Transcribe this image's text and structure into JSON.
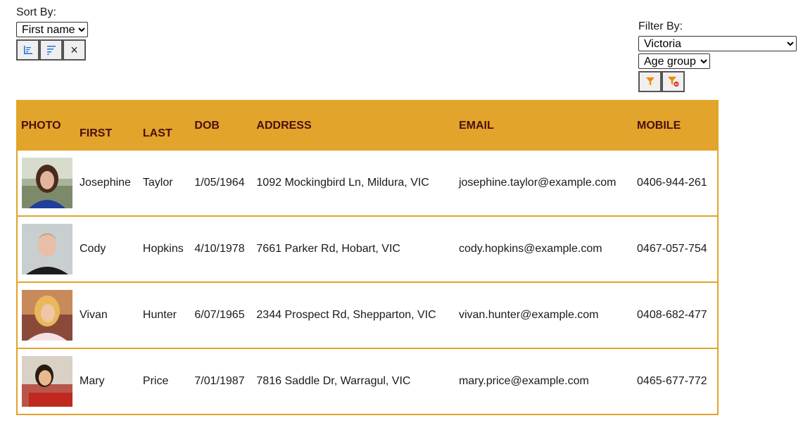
{
  "sort": {
    "label": "Sort By:",
    "selected": "First name",
    "buttons": {
      "ascending": "sort-ascending-icon",
      "descending": "sort-descending-icon",
      "clear": "×"
    }
  },
  "filter": {
    "label": "Filter By:",
    "location_selected": "Victoria",
    "age_selected": "Age group",
    "buttons": {
      "apply": "filter-icon",
      "clear": "filter-clear-icon"
    }
  },
  "table": {
    "columns": [
      "PHOTO",
      "FIRST",
      "LAST",
      "DOB",
      "ADDRESS",
      "EMAIL",
      "MOBILE"
    ],
    "rows": [
      {
        "first": "Josephine",
        "last": "Taylor",
        "dob": "1/05/1964",
        "address": "1092 Mockingbird Ln, Mildura, VIC",
        "email": "josephine.taylor@example.com",
        "mobile": "0406-944-261"
      },
      {
        "first": "Cody",
        "last": "Hopkins",
        "dob": "4/10/1978",
        "address": "7661 Parker Rd, Hobart, VIC",
        "email": "cody.hopkins@example.com",
        "mobile": "0467-057-754"
      },
      {
        "first": "Vivan",
        "last": "Hunter",
        "dob": "6/07/1965",
        "address": "2344 Prospect Rd, Shepparton, VIC",
        "email": "vivan.hunter@example.com",
        "mobile": "0408-682-477"
      },
      {
        "first": "Mary",
        "last": "Price",
        "dob": "7/01/1987",
        "address": "7816 Saddle Dr, Warragul, VIC",
        "email": "mary.price@example.com",
        "mobile": "0465-677-772"
      }
    ]
  },
  "colors": {
    "accent": "#e2a42a",
    "header_text": "#4b0f0f",
    "icon_blue": "#1e6fd9",
    "icon_orange": "#f08a00",
    "icon_red": "#e03030"
  }
}
